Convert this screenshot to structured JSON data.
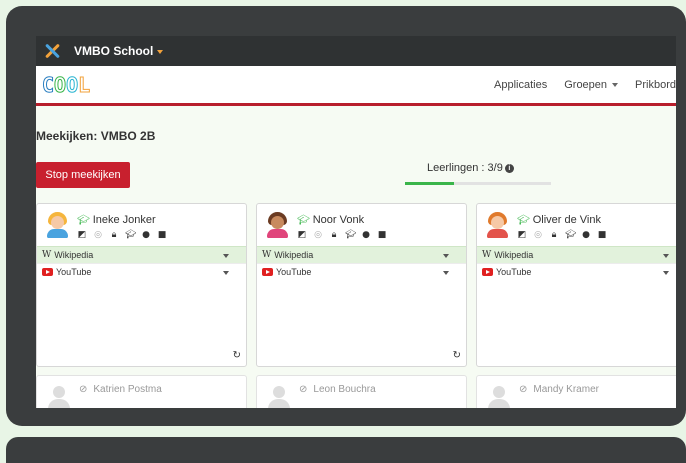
{
  "header": {
    "school": "VMBO School"
  },
  "nav": {
    "brand": "COOL",
    "links": [
      "Applicaties",
      "Groepen",
      "Prikbord"
    ]
  },
  "page": {
    "title": "Meekijken: VMBO 2B",
    "stop_button": "Stop meekijken",
    "students_label": "Leerlingen : 3/9",
    "students_online": 3,
    "students_total": 9
  },
  "colors": {
    "accent": "#c8202e",
    "progress": "#3ab54a",
    "brand_letters": [
      "#2b7fc1",
      "#3ab54a",
      "#2bb5d1",
      "#f2a23b"
    ]
  },
  "students": [
    {
      "name": "Ineke Jonker",
      "tabs": [
        "Wikipedia",
        "YouTube"
      ]
    },
    {
      "name": "Noor Vonk",
      "tabs": [
        "Wikipedia",
        "YouTube"
      ]
    },
    {
      "name": "Oliver de Vink",
      "tabs": [
        "Wikipedia",
        "YouTube"
      ]
    }
  ],
  "offline_students": [
    {
      "name": "Katrien Postma"
    },
    {
      "name": "Leon Bouchra"
    },
    {
      "name": "Mandy Kramer"
    }
  ],
  "icons": [
    "external-link-icon",
    "globe-icon",
    "lock-icon",
    "graduation-cap-icon",
    "chat-icon",
    "video-icon",
    "refresh-icon"
  ]
}
